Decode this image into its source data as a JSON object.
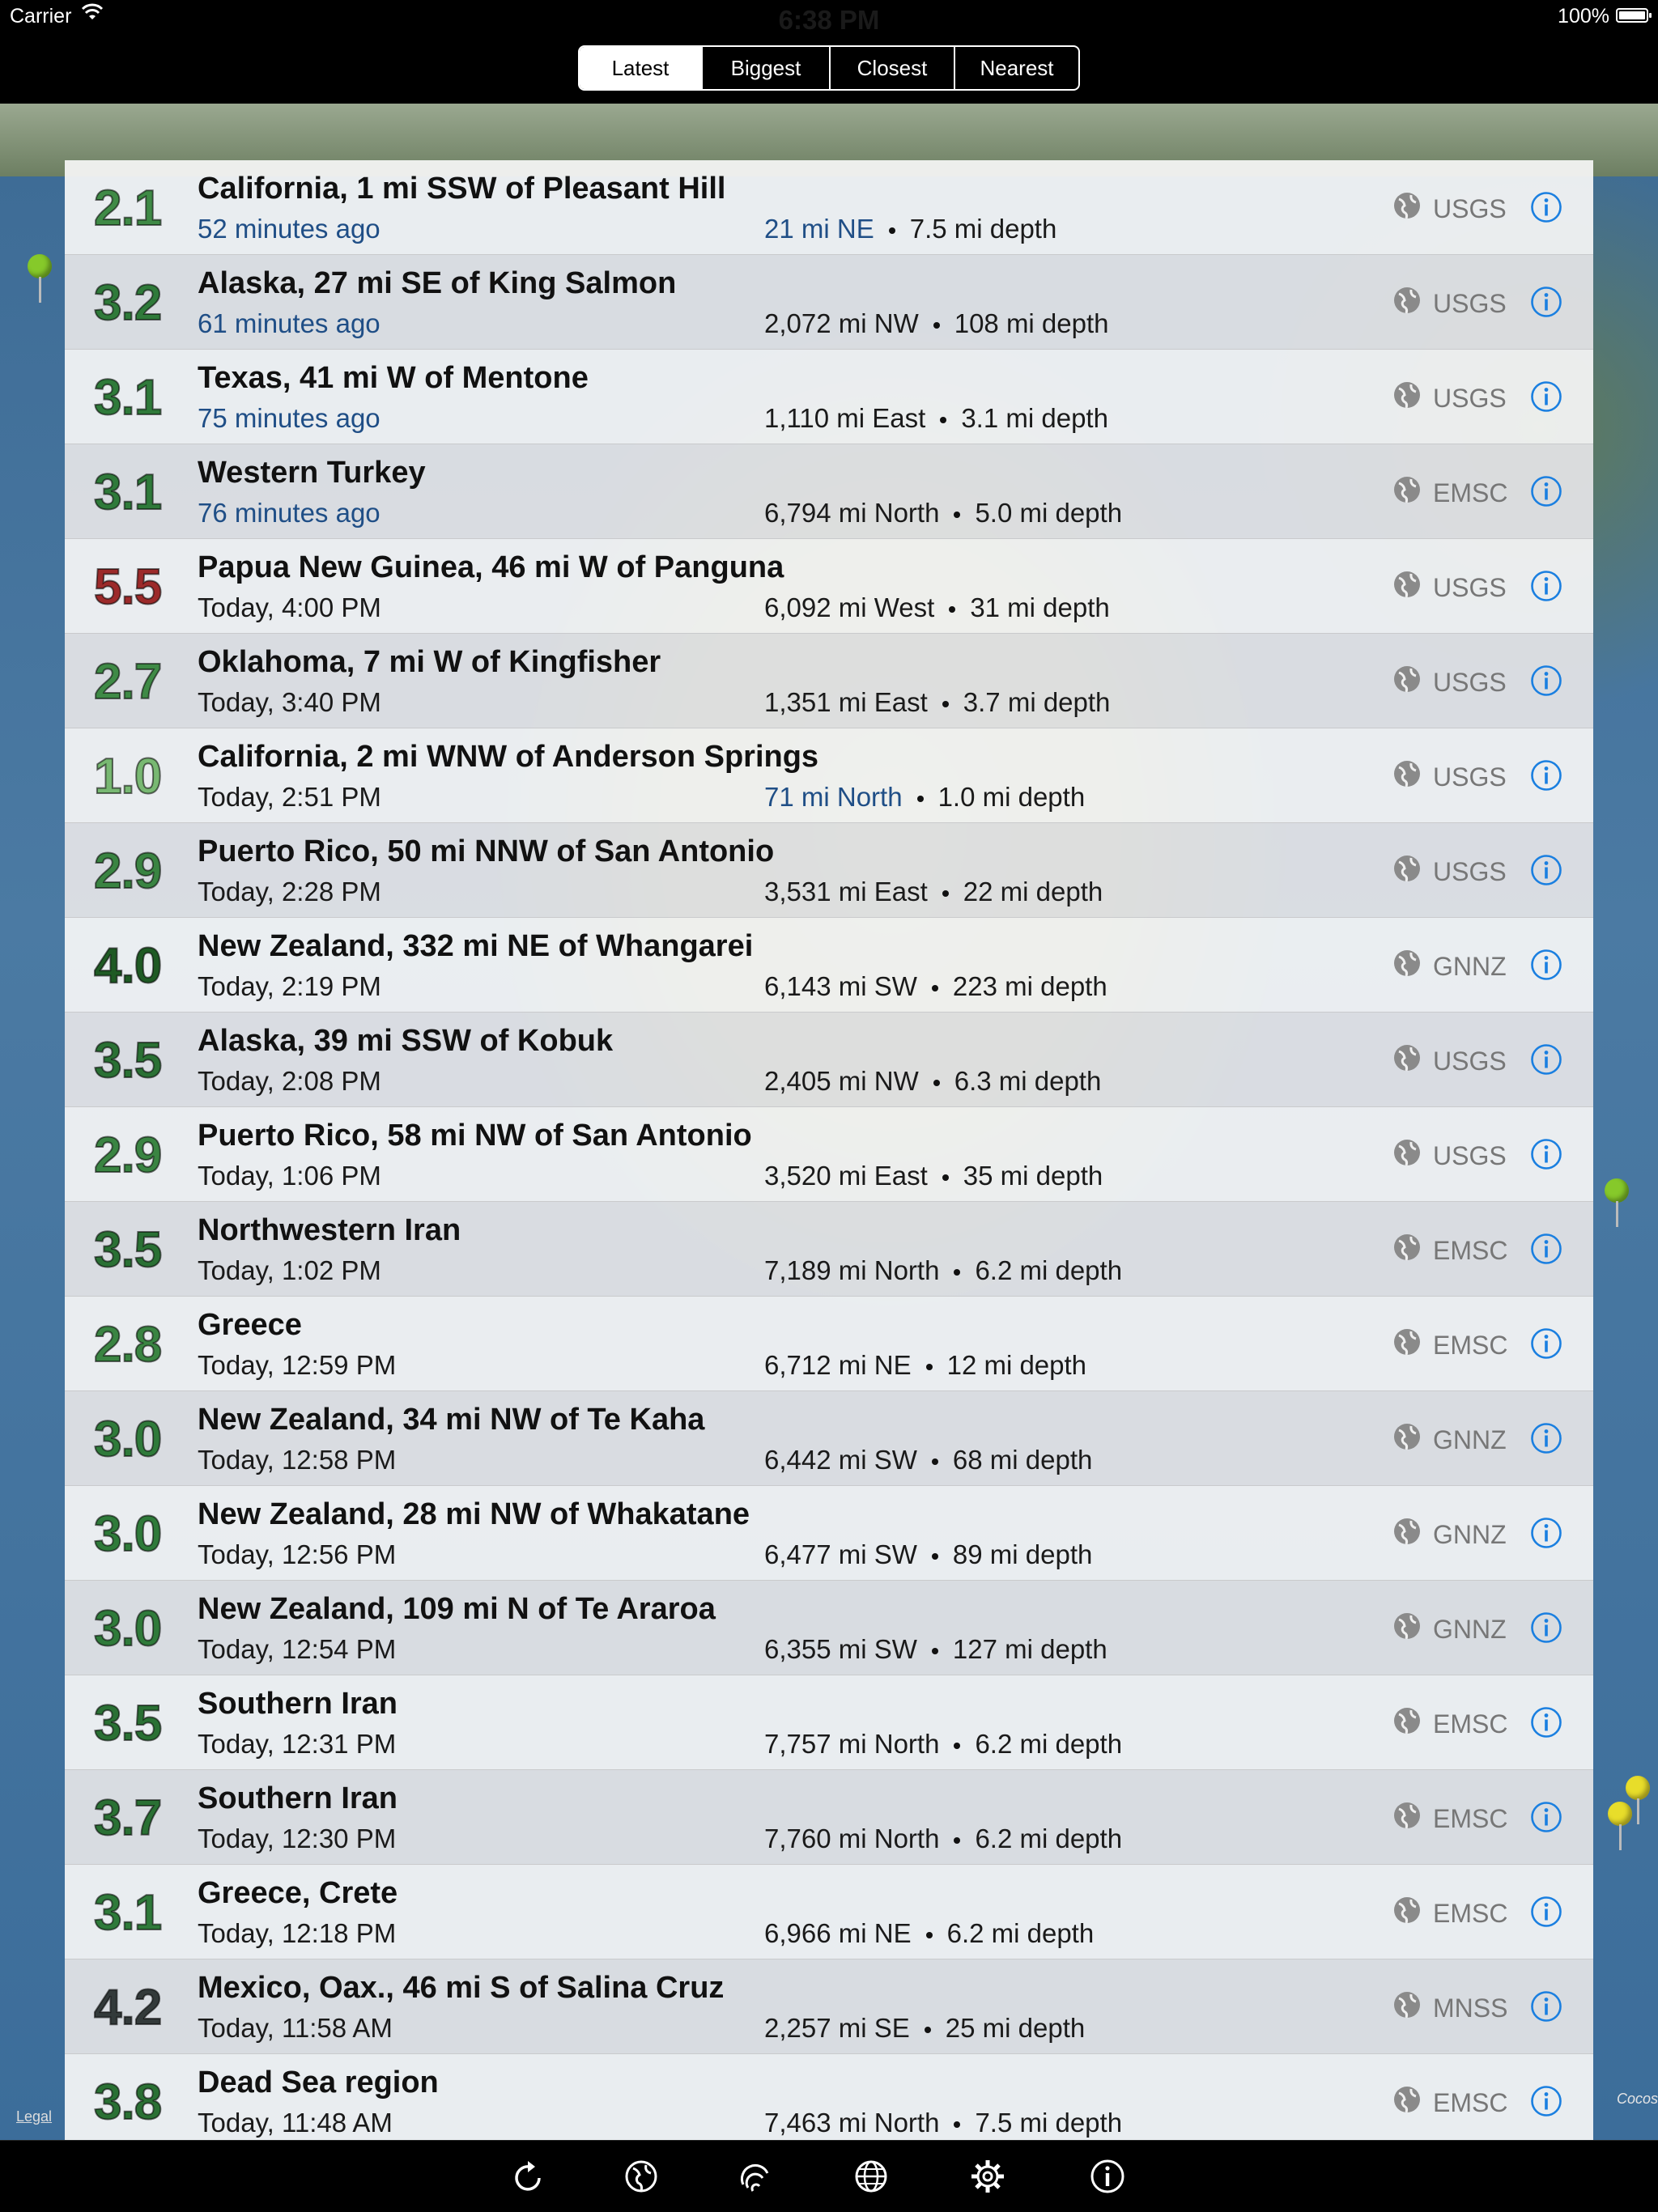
{
  "status_bar": {
    "carrier": "Carrier",
    "time": "6:38 PM",
    "battery": "100%",
    "battery_level": 1.0
  },
  "segments": [
    {
      "label": "Latest",
      "active": true
    },
    {
      "label": "Biggest",
      "active": false
    },
    {
      "label": "Closest",
      "active": false
    },
    {
      "label": "Nearest",
      "active": false
    }
  ],
  "map": {
    "legal": "Legal",
    "place_label": "Cocos"
  },
  "colors": {
    "recent_text": "#1f4e86",
    "info_blue": "#1a7fe0",
    "source_gray": "#777777"
  },
  "quakes": [
    {
      "mag": "2.1",
      "mag_color": "#3f8a46",
      "title": "California, 1 mi SSW of Pleasant Hill",
      "time": "52 minutes ago",
      "time_recent": true,
      "distance": "21 mi NE",
      "distance_recent": true,
      "depth": "7.5 mi depth",
      "source": "USGS"
    },
    {
      "mag": "3.2",
      "mag_color": "#2f7a3a",
      "title": "Alaska, 27 mi SE of King Salmon",
      "time": "61 minutes ago",
      "time_recent": true,
      "distance": "2,072 mi NW",
      "distance_recent": false,
      "depth": "108 mi depth",
      "source": "USGS"
    },
    {
      "mag": "3.1",
      "mag_color": "#2f7a3a",
      "title": "Texas, 41 mi W of Mentone",
      "time": "75 minutes ago",
      "time_recent": true,
      "distance": "1,110 mi East",
      "distance_recent": false,
      "depth": "3.1 mi depth",
      "source": "USGS"
    },
    {
      "mag": "3.1",
      "mag_color": "#2f7a3a",
      "title": "Western Turkey",
      "time": "76 minutes ago",
      "time_recent": true,
      "distance": "6,794 mi North",
      "distance_recent": false,
      "depth": "5.0 mi depth",
      "source": "EMSC"
    },
    {
      "mag": "5.5",
      "mag_color": "#9c2a2a",
      "title": "Papua New Guinea, 46 mi W of Panguna",
      "time": "Today, 4:00 PM",
      "time_recent": false,
      "distance": "6,092 mi West",
      "distance_recent": false,
      "depth": "31 mi depth",
      "source": "USGS"
    },
    {
      "mag": "2.7",
      "mag_color": "#3f8a46",
      "title": "Oklahoma, 7 mi W of Kingfisher",
      "time": "Today, 3:40 PM",
      "time_recent": false,
      "distance": "1,351 mi East",
      "distance_recent": false,
      "depth": "3.7 mi depth",
      "source": "USGS"
    },
    {
      "mag": "1.0",
      "mag_color": "#78b872",
      "title": "California, 2 mi WNW of Anderson Springs",
      "time": "Today, 2:51 PM",
      "time_recent": false,
      "distance": "71 mi North",
      "distance_recent": true,
      "depth": "1.0 mi depth",
      "source": "USGS"
    },
    {
      "mag": "2.9",
      "mag_color": "#3a8442",
      "title": "Puerto Rico, 50 mi NNW of San Antonio",
      "time": "Today, 2:28 PM",
      "time_recent": false,
      "distance": "3,531 mi East",
      "distance_recent": false,
      "depth": "22 mi depth",
      "source": "USGS"
    },
    {
      "mag": "4.0",
      "mag_color": "#1f5a24",
      "title": "New Zealand, 332 mi NE of Whangarei",
      "time": "Today, 2:19 PM",
      "time_recent": false,
      "distance": "6,143 mi SW",
      "distance_recent": false,
      "depth": "223 mi depth",
      "source": "GNNZ"
    },
    {
      "mag": "3.5",
      "mag_color": "#2a7034",
      "title": "Alaska, 39 mi SSW of Kobuk",
      "time": "Today, 2:08 PM",
      "time_recent": false,
      "distance": "2,405 mi NW",
      "distance_recent": false,
      "depth": "6.3 mi depth",
      "source": "USGS"
    },
    {
      "mag": "2.9",
      "mag_color": "#3a8442",
      "title": "Puerto Rico, 58 mi NW of San Antonio",
      "time": "Today, 1:06 PM",
      "time_recent": false,
      "distance": "3,520 mi East",
      "distance_recent": false,
      "depth": "35 mi depth",
      "source": "USGS"
    },
    {
      "mag": "3.5",
      "mag_color": "#2a7034",
      "title": "Northwestern Iran",
      "time": "Today, 1:02 PM",
      "time_recent": false,
      "distance": "7,189 mi North",
      "distance_recent": false,
      "depth": "6.2 mi depth",
      "source": "EMSC"
    },
    {
      "mag": "2.8",
      "mag_color": "#3a8442",
      "title": "Greece",
      "time": "Today, 12:59 PM",
      "time_recent": false,
      "distance": "6,712 mi NE",
      "distance_recent": false,
      "depth": "12 mi depth",
      "source": "EMSC"
    },
    {
      "mag": "3.0",
      "mag_color": "#2f7a3a",
      "title": "New Zealand, 34 mi NW of Te Kaha",
      "time": "Today, 12:58 PM",
      "time_recent": false,
      "distance": "6,442 mi SW",
      "distance_recent": false,
      "depth": "68 mi depth",
      "source": "GNNZ"
    },
    {
      "mag": "3.0",
      "mag_color": "#2f7a3a",
      "title": "New Zealand, 28 mi NW of Whakatane",
      "time": "Today, 12:56 PM",
      "time_recent": false,
      "distance": "6,477 mi SW",
      "distance_recent": false,
      "depth": "89 mi depth",
      "source": "GNNZ"
    },
    {
      "mag": "3.0",
      "mag_color": "#2f7a3a",
      "title": "New Zealand, 109 mi N of Te Araroa",
      "time": "Today, 12:54 PM",
      "time_recent": false,
      "distance": "6,355 mi SW",
      "distance_recent": false,
      "depth": "127 mi depth",
      "source": "GNNZ"
    },
    {
      "mag": "3.5",
      "mag_color": "#2a7034",
      "title": "Southern Iran",
      "time": "Today, 12:31 PM",
      "time_recent": false,
      "distance": "7,757 mi North",
      "distance_recent": false,
      "depth": "6.2 mi depth",
      "source": "EMSC"
    },
    {
      "mag": "3.7",
      "mag_color": "#2a7034",
      "title": "Southern Iran",
      "time": "Today, 12:30 PM",
      "time_recent": false,
      "distance": "7,760 mi North",
      "distance_recent": false,
      "depth": "6.2 mi depth",
      "source": "EMSC"
    },
    {
      "mag": "3.1",
      "mag_color": "#2f7a3a",
      "title": "Greece, Crete",
      "time": "Today, 12:18 PM",
      "time_recent": false,
      "distance": "6,966 mi NE",
      "distance_recent": false,
      "depth": "6.2 mi depth",
      "source": "EMSC"
    },
    {
      "mag": "4.2",
      "mag_color": "#333a3a",
      "title": "Mexico, Oax., 46 mi S of Salina Cruz",
      "time": "Today, 11:58 AM",
      "time_recent": false,
      "distance": "2,257 mi SE",
      "distance_recent": false,
      "depth": "25 mi depth",
      "source": "MNSS"
    },
    {
      "mag": "3.8",
      "mag_color": "#2a7034",
      "title": "Dead Sea region",
      "time": "Today, 11:48 AM",
      "time_recent": false,
      "distance": "7,463 mi North",
      "distance_recent": false,
      "depth": "7.5 mi depth",
      "source": "EMSC"
    }
  ],
  "toolbar": [
    {
      "icon": "refresh-icon"
    },
    {
      "icon": "globe-icon"
    },
    {
      "icon": "seismograph-icon"
    },
    {
      "icon": "globe-grid-icon"
    },
    {
      "icon": "gear-icon"
    },
    {
      "icon": "info-icon"
    }
  ]
}
